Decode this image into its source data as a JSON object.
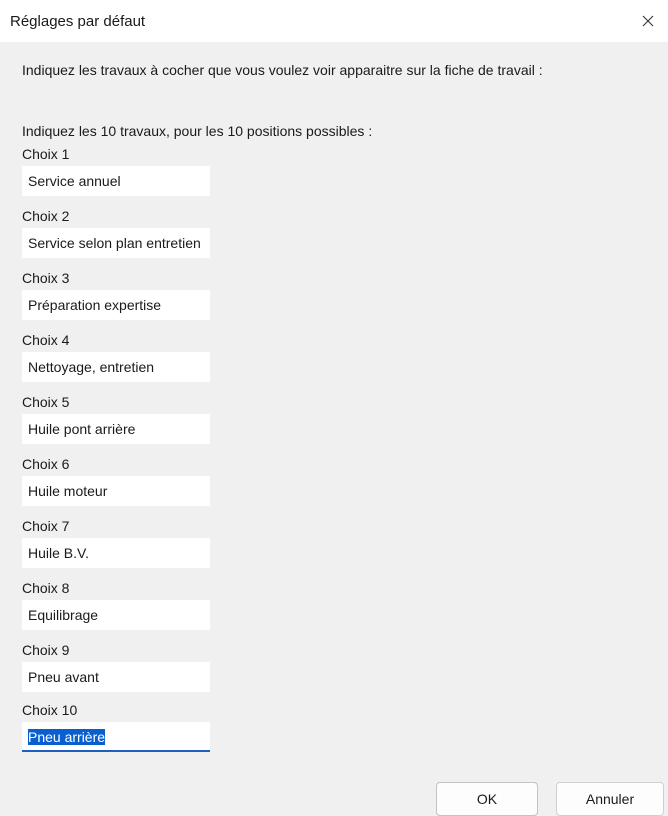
{
  "window": {
    "title": "Réglages par défaut",
    "close_icon": "close-icon"
  },
  "intro_text": "Indiquez les travaux à cocher que vous voulez voir apparaitre sur la fiche de travail :",
  "subintro_text": "Indiquez les 10 travaux, pour les 10 positions possibles :",
  "choices": [
    {
      "label": "Choix 1",
      "value": "Service annuel"
    },
    {
      "label": "Choix 2",
      "value": "Service selon plan entretien"
    },
    {
      "label": "Choix 3",
      "value": "Préparation expertise"
    },
    {
      "label": "Choix 4",
      "value": "Nettoyage, entretien"
    },
    {
      "label": "Choix 5",
      "value": "Huile pont arrière"
    },
    {
      "label": "Choix 6",
      "value": "Huile moteur"
    },
    {
      "label": "Choix 7",
      "value": "Huile B.V."
    },
    {
      "label": "Choix 8",
      "value": "Equilibrage"
    },
    {
      "label": "Choix 9",
      "value": "Pneu avant"
    },
    {
      "label": "Choix 10",
      "value": "Pneu arrière",
      "focused": true,
      "selected": true
    }
  ],
  "buttons": {
    "ok_label": "OK",
    "cancel_label": "Annuler"
  },
  "colors": {
    "accent": "#0a5fd0",
    "dialog_bg": "#f0f0f0"
  }
}
